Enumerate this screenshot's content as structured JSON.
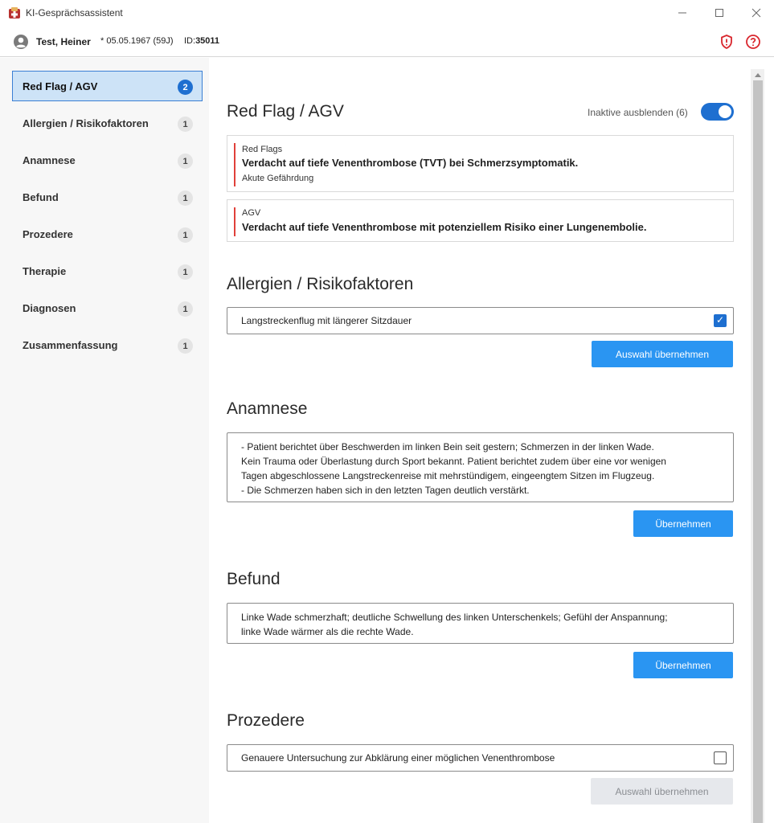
{
  "window": {
    "title": "KI-Gesprächsassistent",
    "min_glyph": "—",
    "max_glyph": "☐",
    "close_glyph": "✕"
  },
  "patient": {
    "name": "Test, Heiner",
    "dob": "* 05.05.1967 (59J)",
    "id_label": "ID:",
    "id_value": "35011",
    "avatar_icon": "user-circle-icon",
    "shield_icon": "shield-alert-icon",
    "help_icon": "help-circle-icon",
    "alert_color": "#d9272e"
  },
  "sidebar": {
    "items": [
      {
        "label": "Red Flag / AGV",
        "count": "2",
        "active": true
      },
      {
        "label": "Allergien / Risikofaktoren",
        "count": "1"
      },
      {
        "label": "Anamnese",
        "count": "1"
      },
      {
        "label": "Befund",
        "count": "1"
      },
      {
        "label": "Prozedere",
        "count": "1"
      },
      {
        "label": "Therapie",
        "count": "1"
      },
      {
        "label": "Diagnosen",
        "count": "1"
      },
      {
        "label": "Zusammenfassung",
        "count": "1"
      }
    ]
  },
  "redflag": {
    "title": "Red Flag / AGV",
    "toggle_label": "Inaktive ausblenden (6)",
    "toggle_on": true,
    "cards": [
      {
        "category": "Red Flags",
        "text": "Verdacht auf tiefe Venenthrombose (TVT) bei Schmerzsymptomatik.",
        "sub": "Akute Gefährdung"
      },
      {
        "category": "AGV",
        "text": "Verdacht auf tiefe Venenthrombose mit potenziellem Risiko einer Lungenembolie."
      }
    ]
  },
  "allergien": {
    "title": "Allergien / Risikofaktoren",
    "item": "Langstreckenflug mit längerer Sitzdauer",
    "checked": true,
    "check_glyph": "✓",
    "button": "Auswahl übernehmen"
  },
  "anamnese": {
    "title": "Anamnese",
    "lines": [
      "- Patient berichtet über Beschwerden im linken Bein seit gestern; Schmerzen in der linken Wade.",
      "Kein Trauma oder Überlastung durch Sport bekannt. Patient berichtet zudem über eine vor wenigen",
      "Tagen abgeschlossene Langstreckenreise mit mehrstündigem, eingeengtem Sitzen im Flugzeug.",
      "- Die Schmerzen haben sich in den letzten Tagen deutlich verstärkt."
    ],
    "button": "Übernehmen"
  },
  "befund": {
    "title": "Befund",
    "lines": [
      "Linke Wade schmerzhaft; deutliche Schwellung des linken Unterschenkels; Gefühl der Anspannung;",
      "linke Wade wärmer als die rechte Wade."
    ],
    "button": "Übernehmen"
  },
  "prozedere": {
    "title": "Prozedere",
    "item": "Genauere Untersuchung zur Abklärung einer möglichen Venenthrombose",
    "checked": false,
    "button": "Auswahl übernehmen"
  },
  "colors": {
    "accent": "#1e6fd0",
    "button": "#2a95f2",
    "flag": "#e0403a"
  }
}
